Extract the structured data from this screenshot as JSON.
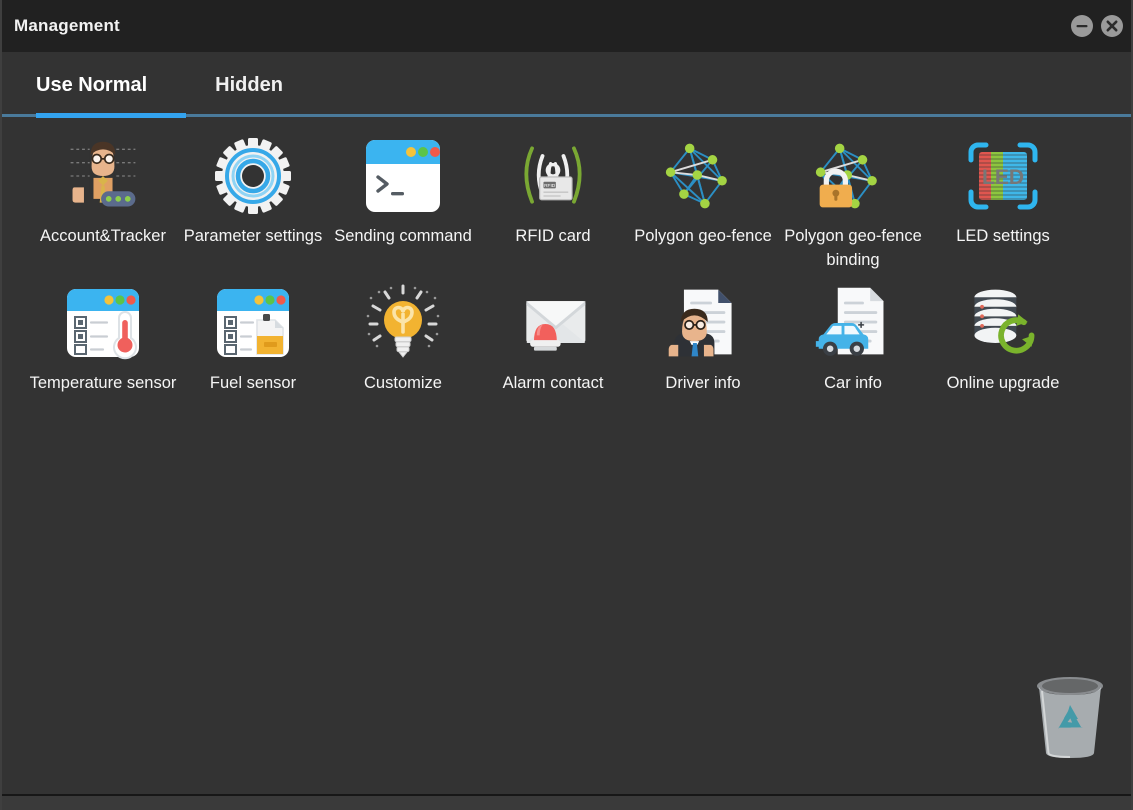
{
  "window": {
    "title": "Management",
    "controls": [
      {
        "name": "minimize",
        "label": "–"
      },
      {
        "name": "close",
        "label": "×"
      }
    ]
  },
  "tabs": [
    {
      "label": "Use Normal",
      "active": true
    },
    {
      "label": "Hidden",
      "active": false
    }
  ],
  "colors": {
    "titlebar_bg": "#212121",
    "content_bg": "#333333",
    "accent_blue": "#33a3ef",
    "underline_base": "#4a7a9b",
    "label_text": "#f5f5f5",
    "win_button": "#9a9a9a"
  },
  "items": [
    {
      "label": "Account&Tracker",
      "icon": "account-tracker-icon"
    },
    {
      "label": "Parameter settings",
      "icon": "gear-icon"
    },
    {
      "label": "Sending command",
      "icon": "terminal-window-icon"
    },
    {
      "label": "RFID card",
      "icon": "rfid-card-icon"
    },
    {
      "label": "Polygon geo-fence",
      "icon": "polygon-geofence-icon"
    },
    {
      "label": "Polygon geo-fence binding",
      "icon": "polygon-geofence-lock-icon"
    },
    {
      "label": "LED settings",
      "icon": "led-panel-icon"
    },
    {
      "label": "Temperature sensor",
      "icon": "thermometer-window-icon"
    },
    {
      "label": "Fuel sensor",
      "icon": "fuel-can-window-icon"
    },
    {
      "label": "Customize",
      "icon": "lightbulb-icon"
    },
    {
      "label": "Alarm contact",
      "icon": "envelope-alarm-icon"
    },
    {
      "label": "Driver info",
      "icon": "driver-document-icon"
    },
    {
      "label": "Car info",
      "icon": "car-document-icon"
    },
    {
      "label": "Online upgrade",
      "icon": "database-refresh-icon"
    }
  ],
  "recycle_bin": {
    "name": "recycle-bin-icon"
  }
}
